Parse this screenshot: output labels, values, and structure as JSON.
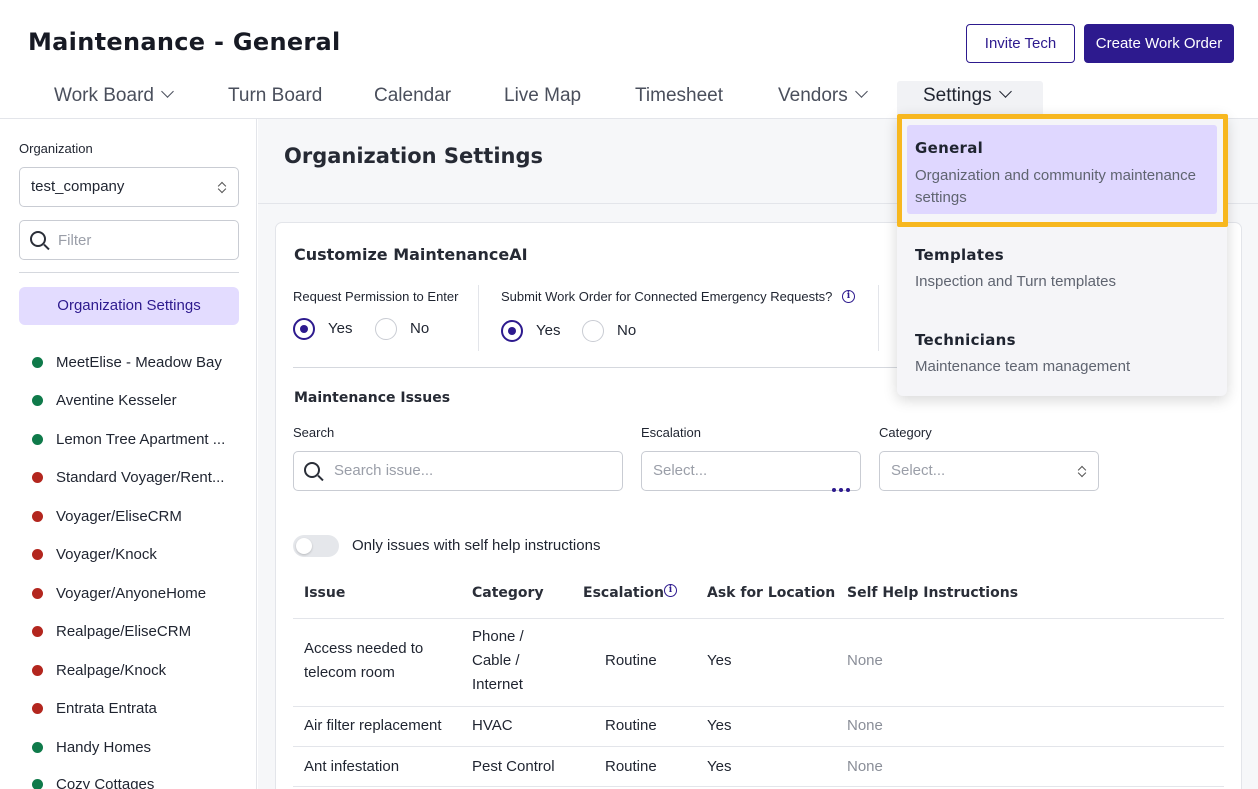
{
  "header": {
    "title": "Maintenance - General",
    "invite_label": "Invite Tech",
    "create_label": "Create Work Order"
  },
  "nav": {
    "items": [
      "Work Board",
      "Turn Board",
      "Calendar",
      "Live Map",
      "Timesheet",
      "Vendors",
      "Settings"
    ],
    "active": "Settings"
  },
  "sidebar": {
    "org_label": "Organization",
    "org_value": "test_company",
    "filter_placeholder": "Filter",
    "active_item": "Organization Settings",
    "communities": [
      {
        "name": "MeetElise - Meadow Bay",
        "status": "green"
      },
      {
        "name": "Aventine Kesseler",
        "status": "green"
      },
      {
        "name": "Lemon Tree Apartment ...",
        "status": "green"
      },
      {
        "name": "Standard Voyager/Rent...",
        "status": "red"
      },
      {
        "name": "Voyager/EliseCRM",
        "status": "red"
      },
      {
        "name": "Voyager/Knock",
        "status": "red"
      },
      {
        "name": "Voyager/AnyoneHome",
        "status": "red"
      },
      {
        "name": "Realpage/EliseCRM",
        "status": "red"
      },
      {
        "name": "Realpage/Knock",
        "status": "red"
      },
      {
        "name": "Entrata Entrata",
        "status": "red"
      },
      {
        "name": "Handy Homes",
        "status": "green"
      },
      {
        "name": "Cozy Cottages",
        "status": "green"
      }
    ],
    "status_colors": {
      "green": "#0f7a4a",
      "red": "#b3261e"
    }
  },
  "main": {
    "title": "Organization Settings",
    "card_title": "Customize MaintenanceAI",
    "q1": {
      "label": "Request Permission to Enter",
      "yes": "Yes",
      "no": "No",
      "value": "Yes"
    },
    "q2": {
      "label": "Submit Work Order for Connected Emergency Requests?",
      "yes": "Yes",
      "no": "No",
      "value": "Yes"
    },
    "issues_title": "Maintenance Issues",
    "search_label": "Search",
    "search_placeholder": "Search issue...",
    "escalation_label": "Escalation",
    "escalation_placeholder": "Select...",
    "category_label": "Category",
    "category_placeholder": "Select...",
    "toggle_label": "Only issues with self help instructions",
    "table": {
      "headers": [
        "Issue",
        "Category",
        "Escalation",
        "Ask for Location",
        "Self Help Instructions"
      ],
      "rows": [
        {
          "issue": "Access needed to telecom room",
          "category": "Phone / Cable / Internet",
          "escalation": "Routine",
          "ask": "Yes",
          "self_help": "None"
        },
        {
          "issue": "Air filter replacement",
          "category": "HVAC",
          "escalation": "Routine",
          "ask": "Yes",
          "self_help": "None"
        },
        {
          "issue": "Ant infestation",
          "category": "Pest Control",
          "escalation": "Routine",
          "ask": "Yes",
          "self_help": "None"
        }
      ]
    }
  },
  "settings_menu": {
    "items": [
      {
        "title": "General",
        "desc": "Organization and community maintenance settings"
      },
      {
        "title": "Templates",
        "desc": "Inspection and Turn templates"
      },
      {
        "title": "Technicians",
        "desc": "Maintenance team management"
      }
    ],
    "selected": "General"
  },
  "colors": {
    "accent": "#2d1a8e",
    "accent_light": "#e3dcff",
    "highlight": "#f7b71f"
  }
}
